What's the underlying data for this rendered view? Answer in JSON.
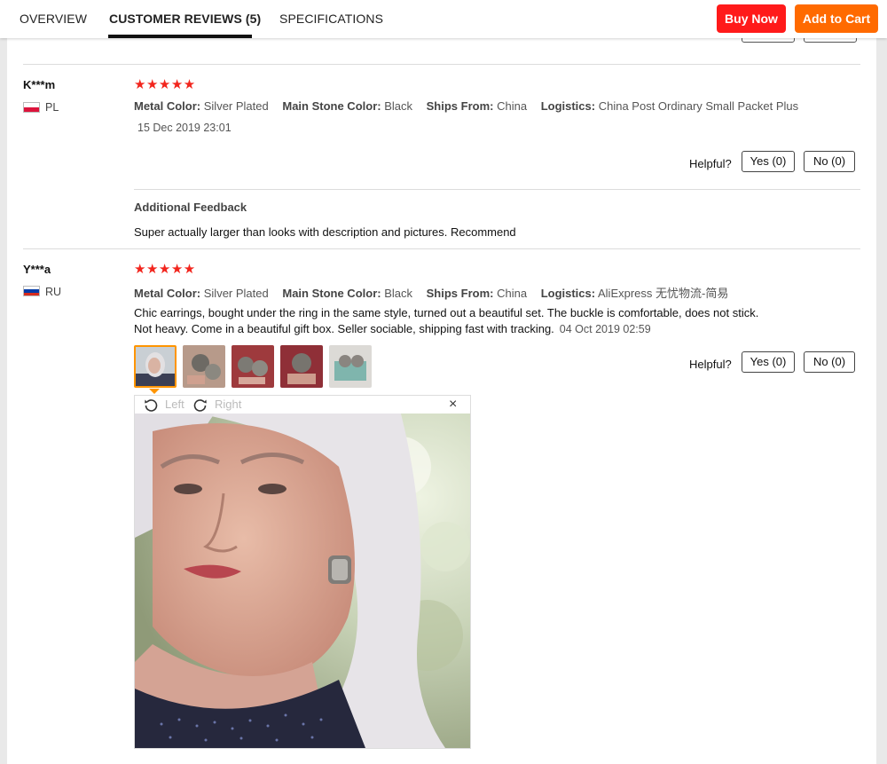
{
  "header": {
    "tabs": [
      {
        "label": "OVERVIEW"
      },
      {
        "label": "CUSTOMER REVIEWS (5)"
      },
      {
        "label": "SPECIFICATIONS"
      }
    ],
    "buy_now": "Buy Now",
    "add_to_cart": "Add to Cart"
  },
  "reviews": [
    {
      "user": "K***m",
      "country": "PL",
      "stars": "★★★★★",
      "attrs": [
        {
          "key": "Metal Color:",
          "value": "Silver Plated"
        },
        {
          "key": "Main Stone Color:",
          "value": "Black"
        },
        {
          "key": "Ships From:",
          "value": "China"
        },
        {
          "key": "Logistics:",
          "value": "China Post Ordinary Small Packet Plus"
        }
      ],
      "date": "15 Dec 2019 23:01",
      "helpful_label": "Helpful?",
      "yes_label": "Yes (0)",
      "no_label": "No (0)",
      "additional_title": "Additional Feedback",
      "additional_text": "Super actually larger than looks with description and pictures. Recommend"
    },
    {
      "user": "Y***a",
      "country": "RU",
      "stars": "★★★★★",
      "attrs": [
        {
          "key": "Metal Color:",
          "value": "Silver Plated"
        },
        {
          "key": "Main Stone Color:",
          "value": "Black"
        },
        {
          "key": "Ships From:",
          "value": "China"
        },
        {
          "key": "Logistics:",
          "value": "AliExpress 无忧物流-简易"
        }
      ],
      "text": "Chic earrings, bought under the ring in the same style, turned out a beautiful set. The buckle is comfortable, does not stick. Not heavy. Come in a beautiful gift box. Seller sociable, shipping fast with tracking.",
      "date": "04 Oct 2019 02:59",
      "helpful_label": "Helpful?",
      "yes_label": "Yes (0)",
      "no_label": "No (0)",
      "viewer": {
        "rotate_left": "Left",
        "rotate_right": "Right",
        "close": "×"
      }
    }
  ],
  "colors": {
    "buy_now": "#ff1a1a",
    "add_to_cart": "#ff6a00",
    "stars": "#f2251d",
    "thumb_selected": "#ff9500"
  }
}
